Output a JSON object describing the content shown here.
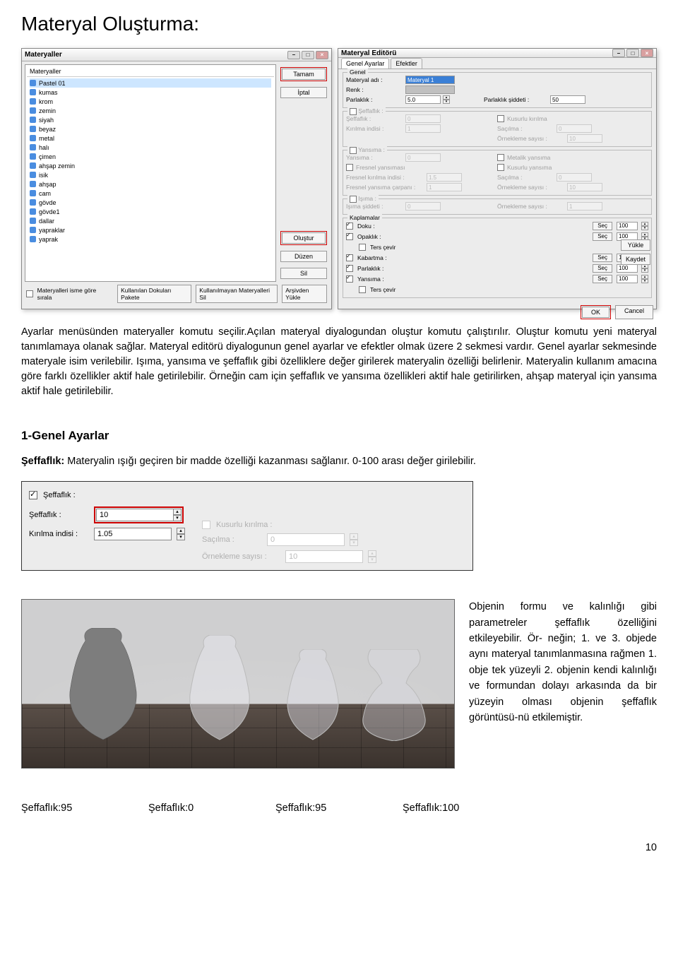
{
  "page": {
    "title": "Materyal Oluşturma:",
    "number": "10"
  },
  "dialog1": {
    "title": "Materyaller",
    "listHeader": "Materyaller",
    "items": [
      "Pastel 01",
      "kumas",
      "krom",
      "zemin",
      "siyah",
      "beyaz",
      "metal",
      "halı",
      "çimen",
      "ahşap zemin",
      "isik",
      "ahşap",
      "cam",
      "gövde",
      "gövde1",
      "dallar",
      "yapraklar",
      "yaprak"
    ],
    "btns": {
      "tamam": "Tamam",
      "iptal": "İptal",
      "olustur": "Oluştur",
      "duzen": "Düzen",
      "sil": "Sil"
    },
    "footer": {
      "sortLabel": "Materyalleri isme göre sırala",
      "b1": "Kullanılan Dokuları Pakete",
      "b2": "Kullanılmayan Materyalleri Sil",
      "b3": "Arşivden Yükle"
    }
  },
  "dialog2": {
    "title": "Materyal Editörü",
    "tabs": {
      "genel": "Genel Ayarlar",
      "efektler": "Efektler"
    },
    "genel": {
      "matAdiLabel": "Materyal adı :",
      "matAdiVal": "Materyal 1",
      "renkLabel": "Renk :",
      "parlakLabel": "Parlaklık :",
      "parlakVal": "5.0",
      "parlakSidLabel": "Parlaklık şiddeti :",
      "parlakSidVal": "50"
    },
    "seffaflik": {
      "group": "Şeffaflık :",
      "sefLabel": "Şeffaflık :",
      "sefVal": "0",
      "kirilmaLabel": "Kırılma indisi :",
      "kirilmaVal": "1",
      "kusurluChk": "Kusurlu kırılma",
      "sacilmaLabel": "Saçılma :",
      "sacilmaVal": "0",
      "orneklemeLabel": "Örnekleme sayısı :",
      "orneklemeVal": "10"
    },
    "yansima": {
      "group": "Yansıma :",
      "yansimaLabel": "Yansıma :",
      "yansimaVal": "0",
      "fresnelChk": "Fresnel yansıması",
      "fresnelKirLabel": "Fresnel kırılma indisi :",
      "fresnelKirVal": "1.5",
      "fresnelCarLabel": "Fresnel yansıma çarpanı :",
      "fresnelCarVal": "1",
      "metalikChk": "Metalik yansıma",
      "kusurluYanChk": "Kusurlu yansıma",
      "sacilmaLabel": "Saçılma :",
      "sacilmaVal": "0",
      "orneklemeLabel": "Örnekleme sayısı :",
      "orneklemeVal": "10"
    },
    "isima": {
      "group": "Işıma :",
      "isimaSidLabel": "Işıma şiddeti :",
      "isimaSidVal": "0",
      "orneklemeLabel": "Örnekleme sayısı :",
      "orneklemeVal": "1"
    },
    "kaplamalar": {
      "group": "Kaplamalar",
      "doku": "Doku :",
      "opaklik": "Opaklık :",
      "tersCevir": "Ters çevir",
      "kabartma": "Kabartma :",
      "parlaklik": "Parlaklık :",
      "yansima": "Yansıma :",
      "secBtn": "Seç",
      "val100": "100"
    },
    "side": {
      "yukle": "Yükle",
      "kaydet": "Kaydet"
    },
    "footer": {
      "ok": "OK",
      "cancel": "Cancel"
    }
  },
  "body": {
    "p1": "Ayarlar menüsünden materyaller komutu seçilir.Açılan materyal diyalogundan oluştur komutu çalıştırılır. Oluştur komutu yeni materyal tanımlamaya olanak sağlar. Materyal editörü diyalogunun genel ayarlar  ve efektler olmak üzere 2 sekmesi vardır. Genel ayarlar sekmesinde materyale isim verilebilir. Işıma, yansıma ve şeffaflık gibi özelliklere değer girilerek materyalin özelliği belirlenir. Materyalin kullanım amacına göre farklı özellikler aktif hale getirilebilir. Örneğin cam için şeffaflık ve yansıma özellikleri aktif hale getirilirken, ahşap materyal için yansıma aktif hale getirilebilir.",
    "h1": "1-Genel Ayarlar",
    "p2pre": "Şeffaflık:",
    "p2": " Materyalin ışığı geçiren bir madde özelliği kazanması sağlanır. 0-100 arası değer girilebilir.",
    "p3": "Objenin formu ve kalınlığı gibi parametreler şeffaflık özelliğini etkileyebilir. Ör- neğin; 1. ve 3. objede aynı materyal tanımlanmasına rağmen 1. obje tek yüzeyli 2. objenin kendi kalınlığı ve formundan dolayı arkasında da bir yüzeyin olması objenin şeffaflık görüntüsü-nü etkilemiştir."
  },
  "sefPanel": {
    "chkLabel": "Şeffaflık :",
    "sefLabel": "Şeffaflık :",
    "sefVal": "10",
    "kirilmaLabel": "Kırılma indisi :",
    "kirilmaVal": "1.05",
    "kusurluLabel": "Kusurlu kırılma :",
    "sacilmaLabel": "Saçılma :",
    "sacilmaVal": "0",
    "orneklemeLabel": "Örnekleme sayısı :",
    "orneklemeVal": "10"
  },
  "sefLabels": {
    "a": "Şeffaflık:95",
    "b": "Şeffaflık:0",
    "c": "Şeffaflık:95",
    "d": "Şeffaflık:100"
  }
}
